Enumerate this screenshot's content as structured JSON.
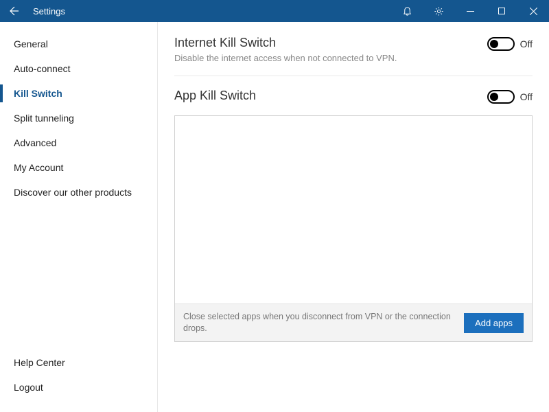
{
  "titlebar": {
    "title": "Settings"
  },
  "sidebar": {
    "items": [
      {
        "label": "General"
      },
      {
        "label": "Auto-connect"
      },
      {
        "label": "Kill Switch"
      },
      {
        "label": "Split tunneling"
      },
      {
        "label": "Advanced"
      },
      {
        "label": "My Account"
      },
      {
        "label": "Discover our other products"
      }
    ],
    "bottom": [
      {
        "label": "Help Center"
      },
      {
        "label": "Logout"
      }
    ]
  },
  "content": {
    "internet_kill": {
      "title": "Internet Kill Switch",
      "subtitle": "Disable the internet access when not connected to VPN.",
      "state_label": "Off"
    },
    "app_kill": {
      "title": "App Kill Switch",
      "state_label": "Off",
      "footer_text": "Close selected apps when you disconnect from VPN or the connection drops.",
      "add_button": "Add apps"
    }
  }
}
